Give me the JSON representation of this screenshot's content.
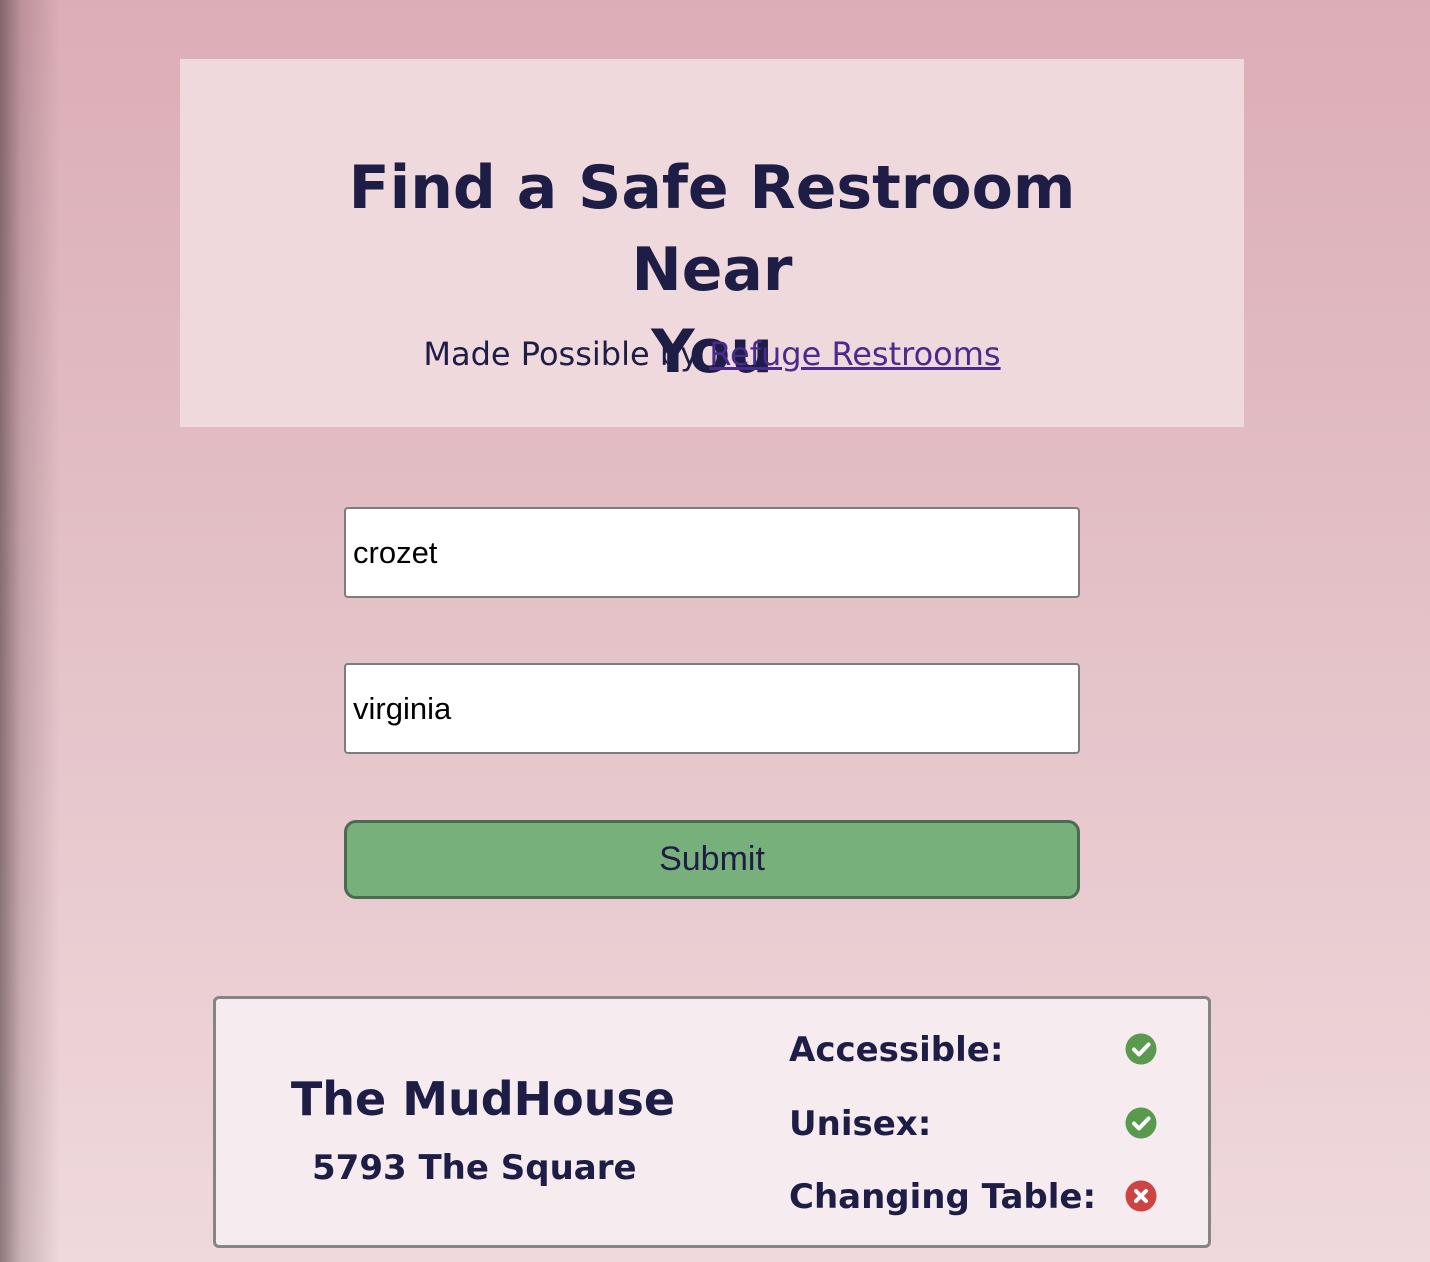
{
  "header": {
    "title_line1": "Find a Safe Restroom Near",
    "title_line2": "You",
    "byline_prefix": "Made Possible by ",
    "byline_link": "Refuge Restrooms"
  },
  "form": {
    "city_value": "crozet",
    "state_value": "virginia",
    "submit_label": "Submit"
  },
  "result": {
    "name": "The MudHouse",
    "address": "5793 The Square",
    "features": [
      {
        "label": "Accessible:",
        "available": true,
        "icon": "check-circle-icon"
      },
      {
        "label": "Unisex:",
        "available": true,
        "icon": "check-circle-icon"
      },
      {
        "label": "Changing Table:",
        "available": false,
        "icon": "x-circle-icon"
      }
    ]
  },
  "colors": {
    "text": "#1d1d45",
    "link": "#4a2a8c",
    "submit_bg": "#78b07c",
    "check": "#5a9a4e",
    "cross": "#cc4444"
  }
}
